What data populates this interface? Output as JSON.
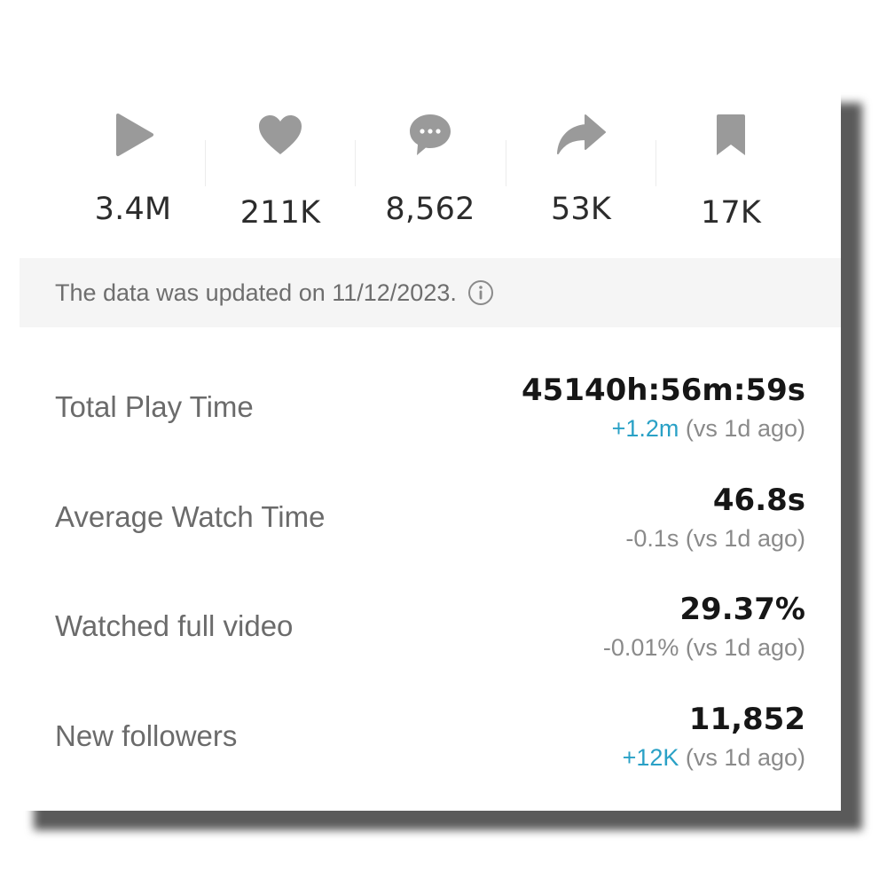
{
  "stats": [
    {
      "icon": "play-icon",
      "value": "3.4M"
    },
    {
      "icon": "heart-icon",
      "value": "211K"
    },
    {
      "icon": "comment-icon",
      "value": "8,562"
    },
    {
      "icon": "share-icon",
      "value": "53K"
    },
    {
      "icon": "bookmark-icon",
      "value": "17K"
    }
  ],
  "banner": {
    "text": "The data was updated on 11/12/2023.",
    "icon": "info-icon"
  },
  "metrics": [
    {
      "label": "Total Play Time",
      "value": "45140h:56m:59s",
      "delta": "+1.2m",
      "delta_suffix": " (vs 1d ago)"
    },
    {
      "label": "Average Watch Time",
      "value": "46.8s",
      "delta": "-0.1s",
      "delta_suffix": " (vs 1d ago)"
    },
    {
      "label": "Watched full video",
      "value": "29.37%",
      "delta": "-0.01%",
      "delta_suffix": " (vs 1d ago)"
    },
    {
      "label": "New followers",
      "value": "11,852",
      "delta": "+12K",
      "delta_suffix": " (vs 1d ago)"
    }
  ],
  "colors": {
    "icon_gray": "#9a9a9a",
    "positive_delta": "#2aa1c6",
    "neutral_delta": "#8a8a8a",
    "banner_bg": "#f5f5f5"
  }
}
